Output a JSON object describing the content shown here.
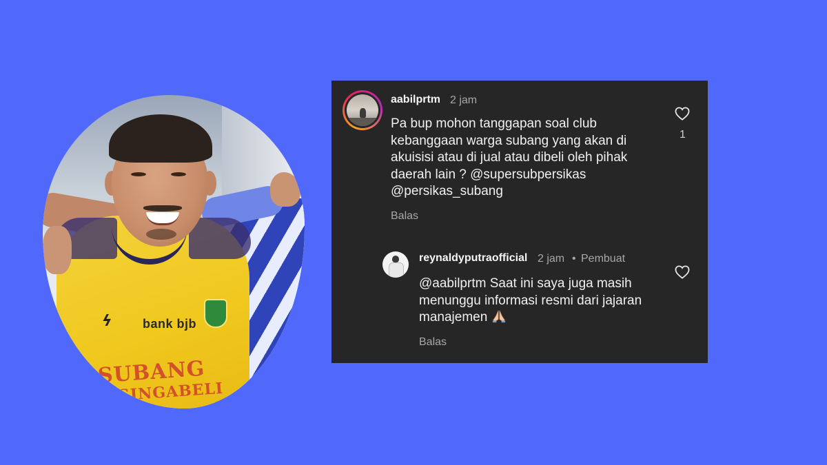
{
  "comment": {
    "username": "aabilprtm",
    "time": "2 jam",
    "text": "Pa bup mohon tanggapan soal club kebanggaan warga subang yang akan di akuisisi atau di jual atau dibeli oleh pihak daerah lain ? @supersubpersikas @persikas_subang",
    "reply_label": "Balas",
    "likes": "1",
    "like_icon": "heart-outline-icon"
  },
  "reply": {
    "username": "reynaldyputraofficial",
    "time": "2 jam",
    "separator": "•",
    "creator_badge": "Pembuat",
    "text": "@aabilprtm Saat ini saya juga masih menunggu informasi resmi dari jajaran manajemen",
    "emoji_icon": "folded-hands-icon",
    "reply_label": "Balas",
    "like_icon": "heart-outline-icon"
  },
  "photo": {
    "sponsor": "bank bjb",
    "chest_text_line1": "SUBANG",
    "chest_text_line2": "SINGABELI"
  },
  "colors": {
    "background": "#5069fb",
    "card": "#262626",
    "text": "#f5f5f5",
    "muted": "#a8a8a8"
  }
}
